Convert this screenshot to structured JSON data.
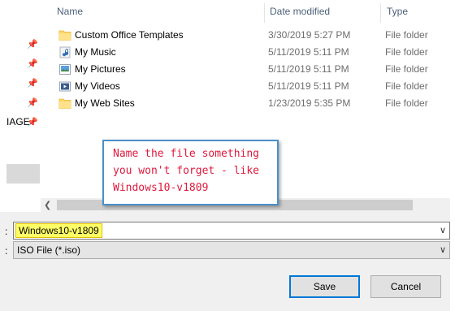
{
  "columns": {
    "name": "Name",
    "date_modified": "Date modified",
    "type": "Type"
  },
  "nav": {
    "label": "IAGE"
  },
  "files": [
    {
      "name": "Custom Office Templates",
      "date": "3/30/2019 5:27 PM",
      "type": "File folder",
      "icon": "folder-icon"
    },
    {
      "name": "My Music",
      "date": "5/11/2019 5:11 PM",
      "type": "File folder",
      "icon": "music-folder-icon"
    },
    {
      "name": "My Pictures",
      "date": "5/11/2019 5:11 PM",
      "type": "File folder",
      "icon": "pictures-folder-icon"
    },
    {
      "name": "My Videos",
      "date": "5/11/2019 5:11 PM",
      "type": "File folder",
      "icon": "videos-folder-icon"
    },
    {
      "name": "My Web Sites",
      "date": "1/23/2019 5:35 PM",
      "type": "File folder",
      "icon": "folder-icon"
    }
  ],
  "form": {
    "filename_label": ":",
    "filename_value": "Windows10-v1809",
    "filetype_label": ":",
    "filetype_value": "ISO File (*.iso)"
  },
  "buttons": {
    "save": "Save",
    "cancel": "Cancel"
  },
  "annotation": {
    "line1": "Name the file something",
    "line2": "you won't forget - like",
    "line3": "Windows10-v1809"
  },
  "colors": {
    "header_text": "#4c607a",
    "annotation_text": "#e0193d",
    "annotation_border": "#4a90c8",
    "highlight": "#ffff66",
    "accent": "#0078d7"
  }
}
